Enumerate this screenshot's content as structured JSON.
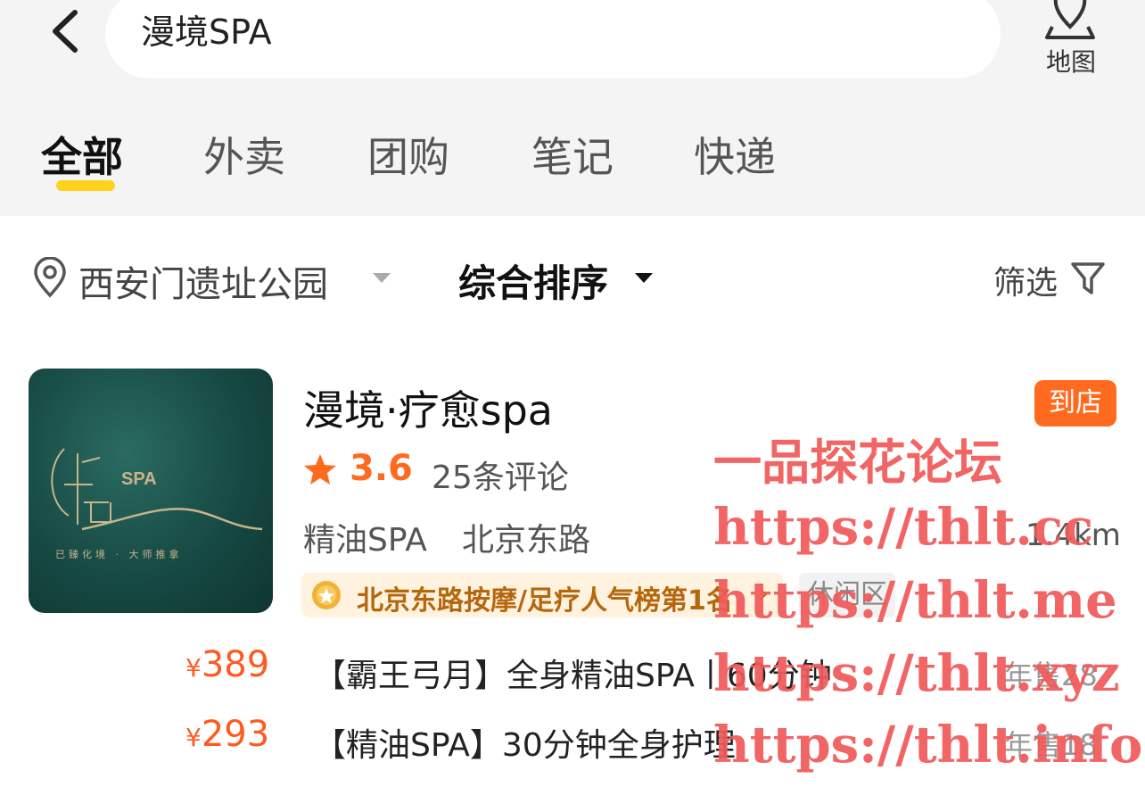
{
  "header": {
    "search_value": "漫境SPA",
    "map_label": "地图"
  },
  "tabs": [
    {
      "label": "全部",
      "active": true
    },
    {
      "label": "外卖",
      "active": false
    },
    {
      "label": "团购",
      "active": false
    },
    {
      "label": "笔记",
      "active": false
    },
    {
      "label": "快递",
      "active": false
    }
  ],
  "filters": {
    "location": "西安门遗址公园",
    "sort": "综合排序",
    "filter": "筛选"
  },
  "shop": {
    "name": "漫境·疗愈spa",
    "badge": "到店",
    "rating": "3.6",
    "reviews": "25条评论",
    "category": "精油SPA",
    "area": "北京东路",
    "distance": "1.4km",
    "rank": "北京东路按摩/足疗人气榜第1名",
    "tag": "休闲区",
    "logo_text": "SPA",
    "logo_slogan": "已臻化境 · 大师推拿"
  },
  "deals": [
    {
      "yen": "¥",
      "price": "389",
      "title": "【霸王弓月】全身精油SPA丨60分钟",
      "sold": "年售28"
    },
    {
      "yen": "¥",
      "price": "293",
      "title": "【精油SPA】30分钟全身护理",
      "sold": "年售18"
    }
  ],
  "watermark": {
    "title": "一品探花论坛",
    "urls": [
      "https://thlt.cc",
      "https://thlt.me",
      "https://thlt.xyz",
      "https://thlt.info"
    ]
  },
  "colors": {
    "accent": "#ff6a1f",
    "tab_underline": "#ffd21e",
    "rank_bg": "#fff3df",
    "watermark": "#f05a5a"
  },
  "icons": [
    "back-arrow-icon",
    "map-pin-icon",
    "location-icon",
    "caret-down-icon",
    "filter-icon",
    "star-icon",
    "medal-icon",
    "chevron-right-icon"
  ]
}
